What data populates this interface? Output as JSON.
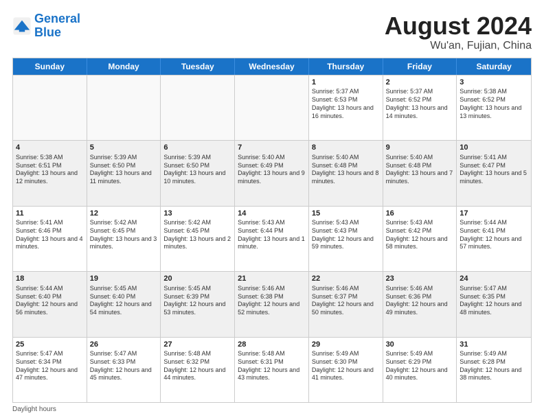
{
  "logo": {
    "line1": "General",
    "line2": "Blue"
  },
  "title": {
    "month_year": "August 2024",
    "location": "Wu'an, Fujian, China"
  },
  "header_days": [
    "Sunday",
    "Monday",
    "Tuesday",
    "Wednesday",
    "Thursday",
    "Friday",
    "Saturday"
  ],
  "footer": {
    "label": "Daylight hours"
  },
  "weeks": [
    {
      "cells": [
        {
          "day": "",
          "text": "",
          "empty": true
        },
        {
          "day": "",
          "text": "",
          "empty": true
        },
        {
          "day": "",
          "text": "",
          "empty": true
        },
        {
          "day": "",
          "text": "",
          "empty": true
        },
        {
          "day": "1",
          "text": "Sunrise: 5:37 AM\nSunset: 6:53 PM\nDaylight: 13 hours\nand 16 minutes.",
          "empty": false
        },
        {
          "day": "2",
          "text": "Sunrise: 5:37 AM\nSunset: 6:52 PM\nDaylight: 13 hours\nand 14 minutes.",
          "empty": false
        },
        {
          "day": "3",
          "text": "Sunrise: 5:38 AM\nSunset: 6:52 PM\nDaylight: 13 hours\nand 13 minutes.",
          "empty": false
        }
      ]
    },
    {
      "cells": [
        {
          "day": "4",
          "text": "Sunrise: 5:38 AM\nSunset: 6:51 PM\nDaylight: 13 hours\nand 12 minutes.",
          "empty": false
        },
        {
          "day": "5",
          "text": "Sunrise: 5:39 AM\nSunset: 6:50 PM\nDaylight: 13 hours\nand 11 minutes.",
          "empty": false
        },
        {
          "day": "6",
          "text": "Sunrise: 5:39 AM\nSunset: 6:50 PM\nDaylight: 13 hours\nand 10 minutes.",
          "empty": false
        },
        {
          "day": "7",
          "text": "Sunrise: 5:40 AM\nSunset: 6:49 PM\nDaylight: 13 hours\nand 9 minutes.",
          "empty": false
        },
        {
          "day": "8",
          "text": "Sunrise: 5:40 AM\nSunset: 6:48 PM\nDaylight: 13 hours\nand 8 minutes.",
          "empty": false
        },
        {
          "day": "9",
          "text": "Sunrise: 5:40 AM\nSunset: 6:48 PM\nDaylight: 13 hours\nand 7 minutes.",
          "empty": false
        },
        {
          "day": "10",
          "text": "Sunrise: 5:41 AM\nSunset: 6:47 PM\nDaylight: 13 hours\nand 5 minutes.",
          "empty": false
        }
      ]
    },
    {
      "cells": [
        {
          "day": "11",
          "text": "Sunrise: 5:41 AM\nSunset: 6:46 PM\nDaylight: 13 hours\nand 4 minutes.",
          "empty": false
        },
        {
          "day": "12",
          "text": "Sunrise: 5:42 AM\nSunset: 6:45 PM\nDaylight: 13 hours\nand 3 minutes.",
          "empty": false
        },
        {
          "day": "13",
          "text": "Sunrise: 5:42 AM\nSunset: 6:45 PM\nDaylight: 13 hours\nand 2 minutes.",
          "empty": false
        },
        {
          "day": "14",
          "text": "Sunrise: 5:43 AM\nSunset: 6:44 PM\nDaylight: 13 hours\nand 1 minute.",
          "empty": false
        },
        {
          "day": "15",
          "text": "Sunrise: 5:43 AM\nSunset: 6:43 PM\nDaylight: 12 hours\nand 59 minutes.",
          "empty": false
        },
        {
          "day": "16",
          "text": "Sunrise: 5:43 AM\nSunset: 6:42 PM\nDaylight: 12 hours\nand 58 minutes.",
          "empty": false
        },
        {
          "day": "17",
          "text": "Sunrise: 5:44 AM\nSunset: 6:41 PM\nDaylight: 12 hours\nand 57 minutes.",
          "empty": false
        }
      ]
    },
    {
      "cells": [
        {
          "day": "18",
          "text": "Sunrise: 5:44 AM\nSunset: 6:40 PM\nDaylight: 12 hours\nand 56 minutes.",
          "empty": false
        },
        {
          "day": "19",
          "text": "Sunrise: 5:45 AM\nSunset: 6:40 PM\nDaylight: 12 hours\nand 54 minutes.",
          "empty": false
        },
        {
          "day": "20",
          "text": "Sunrise: 5:45 AM\nSunset: 6:39 PM\nDaylight: 12 hours\nand 53 minutes.",
          "empty": false
        },
        {
          "day": "21",
          "text": "Sunrise: 5:46 AM\nSunset: 6:38 PM\nDaylight: 12 hours\nand 52 minutes.",
          "empty": false
        },
        {
          "day": "22",
          "text": "Sunrise: 5:46 AM\nSunset: 6:37 PM\nDaylight: 12 hours\nand 50 minutes.",
          "empty": false
        },
        {
          "day": "23",
          "text": "Sunrise: 5:46 AM\nSunset: 6:36 PM\nDaylight: 12 hours\nand 49 minutes.",
          "empty": false
        },
        {
          "day": "24",
          "text": "Sunrise: 5:47 AM\nSunset: 6:35 PM\nDaylight: 12 hours\nand 48 minutes.",
          "empty": false
        }
      ]
    },
    {
      "cells": [
        {
          "day": "25",
          "text": "Sunrise: 5:47 AM\nSunset: 6:34 PM\nDaylight: 12 hours\nand 47 minutes.",
          "empty": false
        },
        {
          "day": "26",
          "text": "Sunrise: 5:47 AM\nSunset: 6:33 PM\nDaylight: 12 hours\nand 45 minutes.",
          "empty": false
        },
        {
          "day": "27",
          "text": "Sunrise: 5:48 AM\nSunset: 6:32 PM\nDaylight: 12 hours\nand 44 minutes.",
          "empty": false
        },
        {
          "day": "28",
          "text": "Sunrise: 5:48 AM\nSunset: 6:31 PM\nDaylight: 12 hours\nand 43 minutes.",
          "empty": false
        },
        {
          "day": "29",
          "text": "Sunrise: 5:49 AM\nSunset: 6:30 PM\nDaylight: 12 hours\nand 41 minutes.",
          "empty": false
        },
        {
          "day": "30",
          "text": "Sunrise: 5:49 AM\nSunset: 6:29 PM\nDaylight: 12 hours\nand 40 minutes.",
          "empty": false
        },
        {
          "day": "31",
          "text": "Sunrise: 5:49 AM\nSunset: 6:28 PM\nDaylight: 12 hours\nand 38 minutes.",
          "empty": false
        }
      ]
    }
  ]
}
